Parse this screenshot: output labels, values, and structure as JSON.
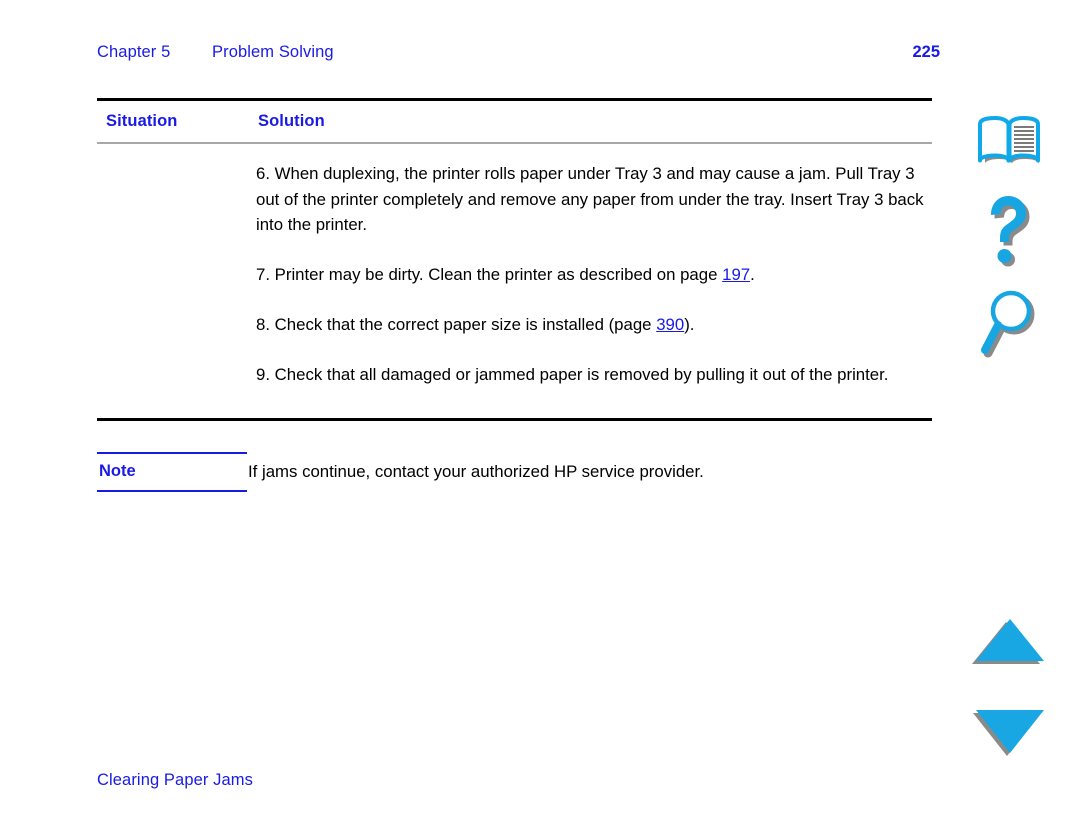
{
  "header": {
    "chapter_label": "Chapter 5",
    "chapter_title": "Problem Solving",
    "page_number": "225"
  },
  "table": {
    "columns": [
      "Situation",
      "Solution"
    ],
    "situation_cell": "",
    "solution_items": [
      {
        "number": "6.",
        "text_before": "When duplexing, the printer rolls paper under Tray 3 and may cause a jam. Pull Tray 3 out of the printer completely and remove any paper from under the tray. Insert Tray 3 back into the printer.",
        "link": "",
        "text_after": ""
      },
      {
        "number": "7.",
        "text_before": "Printer may be dirty. Clean the printer as described on page ",
        "link": "197",
        "text_after": "."
      },
      {
        "number": "8.",
        "text_before": "Check that the correct paper size is installed (page ",
        "link": "390",
        "text_after": ")."
      },
      {
        "number": "9.",
        "text_before": "Check that all damaged or jammed paper is removed by pulling it out of the printer.",
        "link": "",
        "text_after": ""
      }
    ]
  },
  "note": {
    "label": "Note",
    "text": "If jams continue, contact your authorized HP service provider."
  },
  "footer": {
    "section_title": "Clearing Paper Jams"
  },
  "icon_rail": {
    "items": [
      {
        "name": "book-icon",
        "label": "Contents"
      },
      {
        "name": "help-icon",
        "label": "Help"
      },
      {
        "name": "search-icon",
        "label": "Search"
      },
      {
        "name": "arrow-up-icon",
        "label": "Previous Page"
      },
      {
        "name": "arrow-down-icon",
        "label": "Next Page"
      }
    ]
  },
  "colors": {
    "link_blue": "#1a1ae6",
    "accent_cyan": "#1ba3e0",
    "shadow_gray": "#808080",
    "rule_black": "#000000",
    "rule_gray": "#a8a8a8"
  }
}
